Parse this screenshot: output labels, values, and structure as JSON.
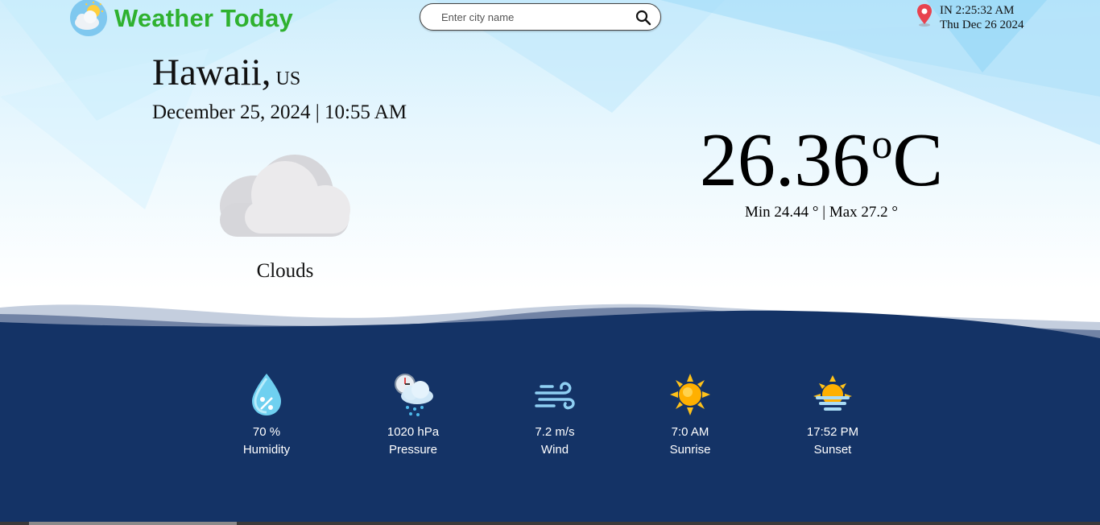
{
  "app": {
    "title": "Weather Today",
    "logo_icon": "partly-cloudy-icon"
  },
  "search": {
    "placeholder": "Enter city name",
    "value": "",
    "icon": "search-icon"
  },
  "local_time": {
    "icon": "map-pin-icon",
    "time": "IN 2:25:32 AM",
    "date": "Thu Dec 26 2024"
  },
  "location": {
    "city": "Hawaii,",
    "country": "US",
    "datetime": "December 25, 2024 | 10:55 AM"
  },
  "condition": {
    "label": "Clouds",
    "icon": "cloud-icon"
  },
  "temperature": {
    "value": "26.36",
    "degree": "o",
    "unit": "C",
    "minmax": "Min 24.44 ° | Max 27.2 °"
  },
  "stats": [
    {
      "value": "70 %",
      "label": "Humidity",
      "icon": "humidity-drop-icon"
    },
    {
      "value": "1020 hPa",
      "label": "Pressure",
      "icon": "pressure-gauge-icon"
    },
    {
      "value": "7.2 m/s",
      "label": "Wind",
      "icon": "wind-icon"
    },
    {
      "value": "7:0 AM",
      "label": "Sunrise",
      "icon": "sun-icon"
    },
    {
      "value": "17:52 PM",
      "label": "Sunset",
      "icon": "sunset-icon"
    }
  ],
  "colors": {
    "brand_green": "#2fb12f",
    "footer_navy": "#143366",
    "sky": "#cfeefc"
  }
}
